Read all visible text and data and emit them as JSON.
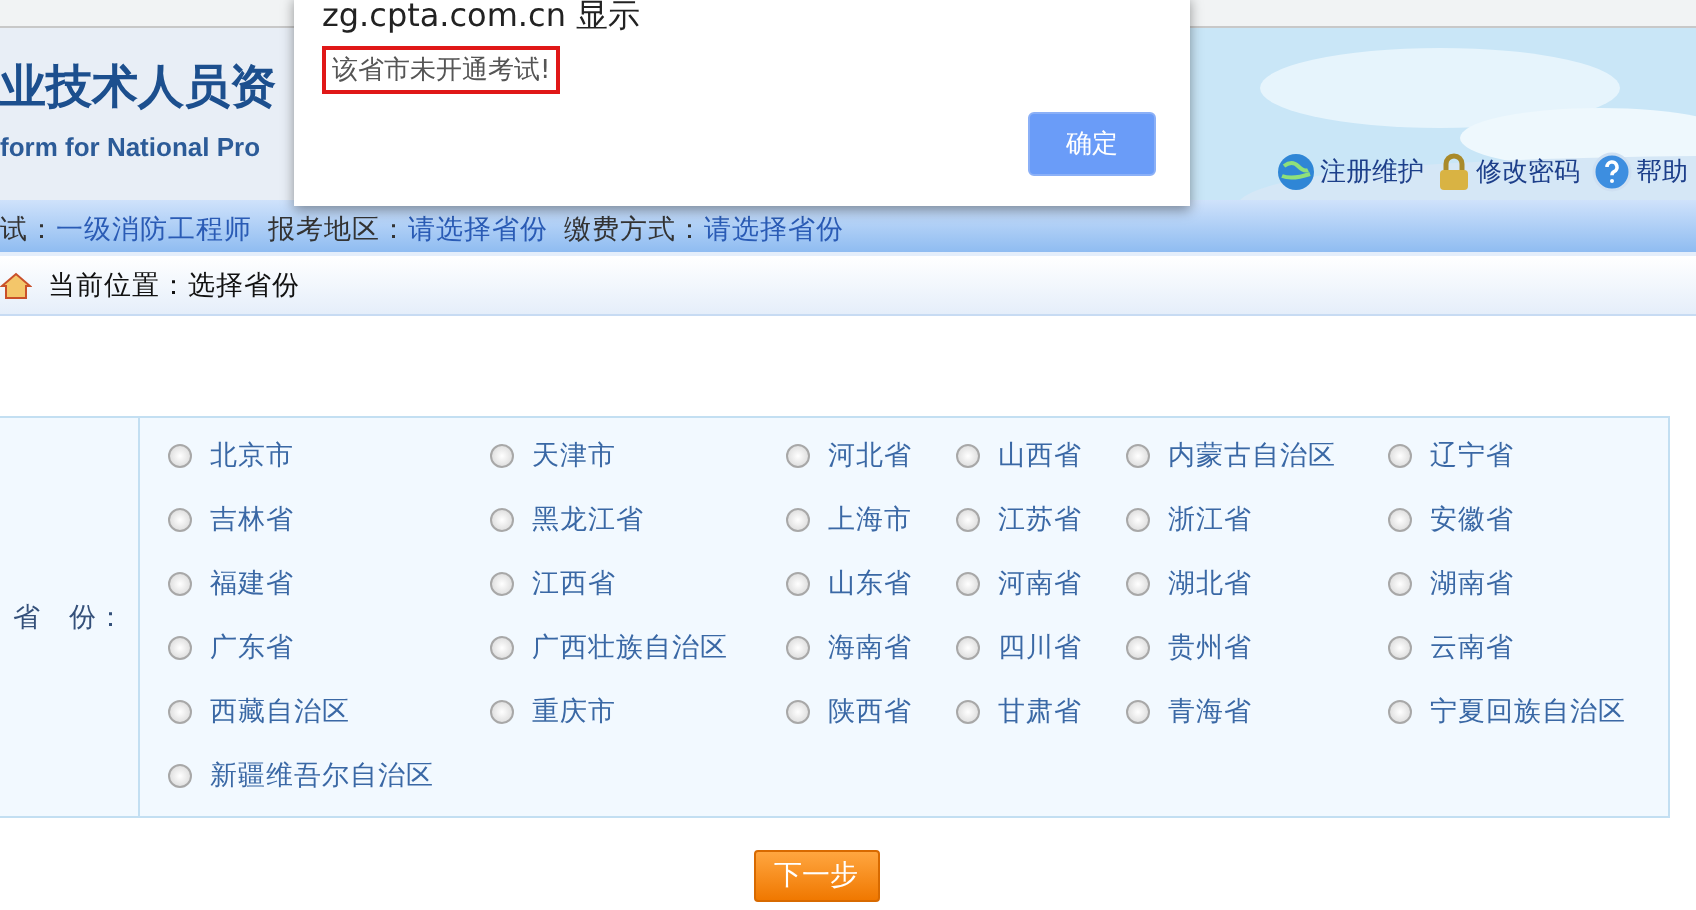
{
  "header": {
    "title": "业技术人员资",
    "subtitle": "form for National Pro",
    "links": [
      {
        "kind": "globe",
        "label": "注册维护"
      },
      {
        "kind": "lock",
        "label": "修改密码"
      },
      {
        "kind": "help",
        "label": "帮助"
      }
    ]
  },
  "info_bar": [
    {
      "label": "试：",
      "value": "一级消防工程师"
    },
    {
      "label": "报考地区：",
      "value": "请选择省份"
    },
    {
      "label": "缴费方式：",
      "value": "请选择省份"
    }
  ],
  "breadcrumb": "当前位置：选择省份",
  "province_field": {
    "label": "省　份：",
    "options": [
      [
        {
          "label": "北京市",
          "selected": false
        },
        {
          "label": "天津市",
          "selected": false
        },
        {
          "label": "河北省",
          "selected": false
        },
        {
          "label": "山西省",
          "selected": false
        },
        {
          "label": "内蒙古自治区",
          "selected": false
        },
        {
          "label": "辽宁省",
          "selected": false
        }
      ],
      [
        {
          "label": "吉林省",
          "selected": false
        },
        {
          "label": "黑龙江省",
          "selected": false
        },
        {
          "label": "上海市",
          "selected": false
        },
        {
          "label": "江苏省",
          "selected": false
        },
        {
          "label": "浙江省",
          "selected": false
        },
        {
          "label": "安徽省",
          "selected": false
        }
      ],
      [
        {
          "label": "福建省",
          "selected": false
        },
        {
          "label": "江西省",
          "selected": false
        },
        {
          "label": "山东省",
          "selected": false
        },
        {
          "label": "河南省",
          "selected": false
        },
        {
          "label": "湖北省",
          "selected": false
        },
        {
          "label": "湖南省",
          "selected": false
        }
      ],
      [
        {
          "label": "广东省",
          "selected": false
        },
        {
          "label": "广西壮族自治区",
          "selected": false
        },
        {
          "label": "海南省",
          "selected": false
        },
        {
          "label": "四川省",
          "selected": false
        },
        {
          "label": "贵州省",
          "selected": false
        },
        {
          "label": "云南省",
          "selected": false
        }
      ],
      [
        {
          "label": "西藏自治区",
          "selected": false
        },
        {
          "label": "重庆市",
          "selected": false
        },
        {
          "label": "陕西省",
          "selected": false
        },
        {
          "label": "甘肃省",
          "selected": false
        },
        {
          "label": "青海省",
          "selected": false
        },
        {
          "label": "宁夏回族自治区",
          "selected": false
        }
      ],
      [
        {
          "label": "新疆维吾尔自治区",
          "selected": false
        }
      ]
    ]
  },
  "next_button": "下一步",
  "dialog": {
    "title": "zg.cpta.com.cn 显示",
    "message": "该省市未开通考试!",
    "ok_button": "确定"
  }
}
